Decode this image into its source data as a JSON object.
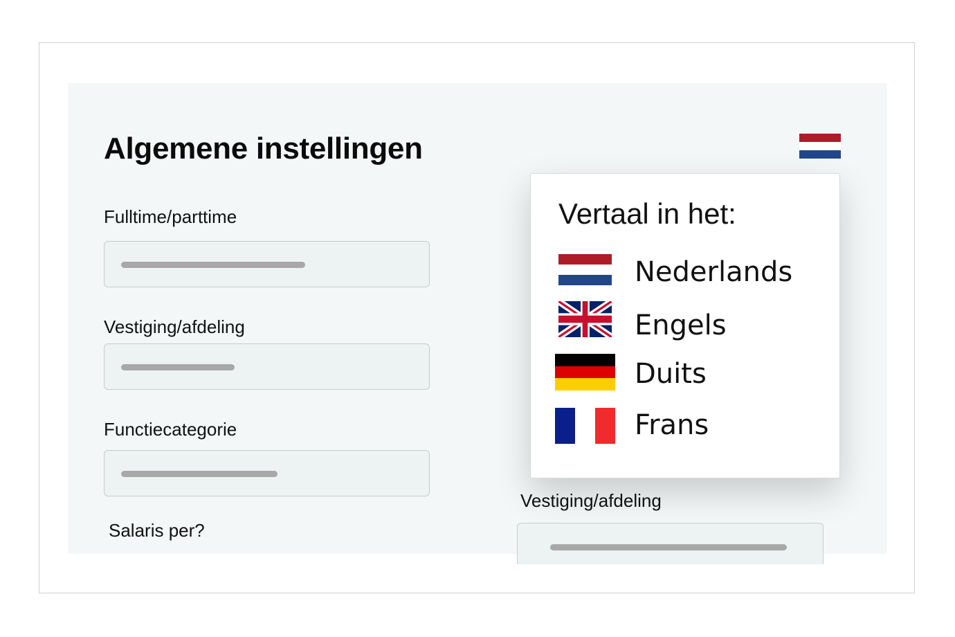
{
  "page": {
    "title": "Algemene instellingen"
  },
  "form": {
    "fields": [
      {
        "label": "Fulltime/parttime"
      },
      {
        "label": "Vestiging/afdeling"
      },
      {
        "label": "Functiecategorie"
      },
      {
        "label": "Salaris per?"
      }
    ],
    "right_field": {
      "label": "Vestiging/afdeling"
    }
  },
  "language_menu": {
    "title": "Vertaal in het:",
    "current_flag": "netherlands-flag-icon",
    "options": [
      {
        "label": "Nederlands",
        "icon": "netherlands-flag-icon"
      },
      {
        "label": "Engels",
        "icon": "uk-flag-icon"
      },
      {
        "label": "Duits",
        "icon": "germany-flag-icon"
      },
      {
        "label": "Frans",
        "icon": "france-flag-icon"
      }
    ]
  },
  "colors": {
    "panel_background": "#f3f7f7",
    "field_background": "#edf2f2",
    "placeholder_bar": "#a8a8a8",
    "nl_red": "#ae1c28",
    "nl_blue": "#21468b",
    "de_red": "#dd0000",
    "de_gold": "#ffce00",
    "fr_blue": "#0a1e8c",
    "fr_red": "#ef2b2d"
  }
}
